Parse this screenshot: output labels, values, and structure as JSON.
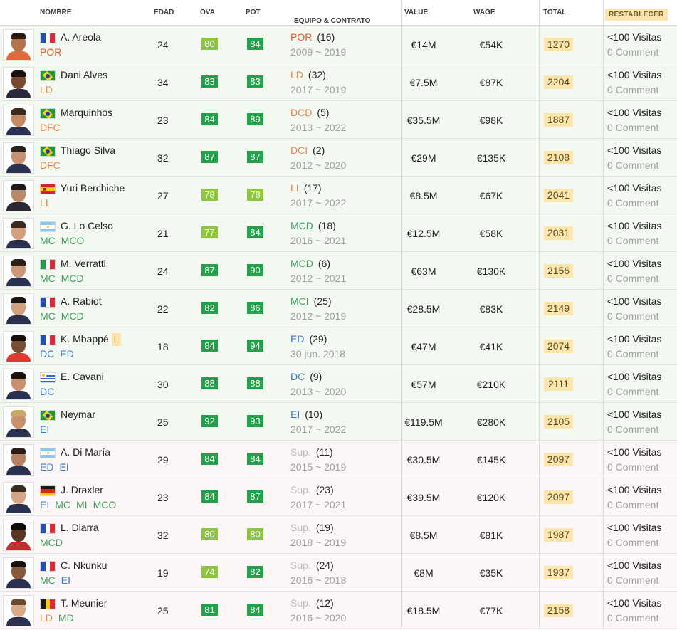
{
  "header": {
    "name": "NOMBRE",
    "age": "EDAD",
    "ova": "OVA",
    "pot": "POT",
    "team": "EQUIPO & CONTRATO",
    "value": "VALUE",
    "wage": "WAGE",
    "total": "TOTAL",
    "reset": "RESTABLECER"
  },
  "colors": {
    "green_dark": "#22a14a",
    "green_light": "#8cc63f",
    "pos_orange": "#e8874a",
    "pos_red": "#e5572a",
    "pos_green": "#3f9e5e",
    "pos_blue": "#3c7ac7",
    "sub_grey": "#bdbdbd",
    "total_bg": "#fbe5ad"
  },
  "players": [
    {
      "name": "A. Areola",
      "flag": "france",
      "positions": [
        "POR"
      ],
      "pos_color": "#e5572a",
      "age": "24",
      "ova": "80",
      "ova_color": "#8cc63f",
      "pot": "84",
      "pot_color": "#22a14a",
      "team_pos": "POR",
      "team_color": "#e5572a",
      "num": "(16)",
      "contract": "2009 ~ 2019",
      "value": "€14M",
      "wage": "€54K",
      "total": "1270",
      "visits": "<100 Visitas",
      "comments": "0 Comment",
      "bg": "green",
      "skin": "#b5714a",
      "hair": "#2a1a10",
      "shirt": "#e06b3a"
    },
    {
      "name": "Dani Alves",
      "flag": "brazil",
      "positions": [
        "LD"
      ],
      "pos_color": "#e8874a",
      "age": "34",
      "ova": "83",
      "ova_color": "#22a14a",
      "pot": "83",
      "pot_color": "#22a14a",
      "team_pos": "LD",
      "team_color": "#e8874a",
      "num": "(32)",
      "contract": "2017 ~ 2019",
      "value": "€7.5M",
      "wage": "€87K",
      "total": "2204",
      "visits": "<100 Visitas",
      "comments": "0 Comment",
      "bg": "green",
      "skin": "#7a4a30",
      "hair": "#1a1210",
      "shirt": "#2a2a3a"
    },
    {
      "name": "Marquinhos",
      "flag": "brazil",
      "positions": [
        "DFC"
      ],
      "pos_color": "#e8874a",
      "age": "23",
      "ova": "84",
      "ova_color": "#22a14a",
      "pot": "89",
      "pot_color": "#22a14a",
      "team_pos": "DCD",
      "team_color": "#e8874a",
      "num": "(5)",
      "contract": "2013 ~ 2022",
      "value": "€35.5M",
      "wage": "€98K",
      "total": "1887",
      "visits": "<100 Visitas",
      "comments": "0 Comment",
      "bg": "green",
      "skin": "#c48a64",
      "hair": "#3a2a1e",
      "shirt": "#2a3050"
    },
    {
      "name": "Thiago Silva",
      "flag": "brazil",
      "positions": [
        "DFC"
      ],
      "pos_color": "#e8874a",
      "age": "32",
      "ova": "87",
      "ova_color": "#22a14a",
      "pot": "87",
      "pot_color": "#22a14a",
      "team_pos": "DCI",
      "team_color": "#e8874a",
      "num": "(2)",
      "contract": "2012 ~ 2020",
      "value": "€29M",
      "wage": "€135K",
      "total": "2108",
      "visits": "<100 Visitas",
      "comments": "0 Comment",
      "bg": "green",
      "skin": "#c89070",
      "hair": "#2a2420",
      "shirt": "#2a3050"
    },
    {
      "name": "Yuri Berchiche",
      "flag": "spain",
      "positions": [
        "LI"
      ],
      "pos_color": "#e8874a",
      "age": "27",
      "ova": "78",
      "ova_color": "#8cc63f",
      "pot": "78",
      "pot_color": "#8cc63f",
      "team_pos": "LI",
      "team_color": "#e8874a",
      "num": "(17)",
      "contract": "2017 ~ 2022",
      "value": "€8.5M",
      "wage": "€67K",
      "total": "2041",
      "visits": "<100 Visitas",
      "comments": "0 Comment",
      "bg": "green",
      "skin": "#b88868",
      "hair": "#1e1814",
      "shirt": "#2a2a34"
    },
    {
      "name": "G. Lo Celso",
      "flag": "argentina",
      "positions": [
        "MC",
        "MCO"
      ],
      "pos_color": "#3f9e5e",
      "age": "21",
      "ova": "77",
      "ova_color": "#8cc63f",
      "pot": "84",
      "pot_color": "#22a14a",
      "team_pos": "MCD",
      "team_color": "#3f9e5e",
      "num": "(18)",
      "contract": "2016 ~ 2021",
      "value": "€12.5M",
      "wage": "€58K",
      "total": "2031",
      "visits": "<100 Visitas",
      "comments": "0 Comment",
      "bg": "green",
      "skin": "#d4a080",
      "hair": "#3a2a20",
      "shirt": "#2a3050"
    },
    {
      "name": "M. Verratti",
      "flag": "italy",
      "positions": [
        "MC",
        "MCD"
      ],
      "pos_color": "#3f9e5e",
      "age": "24",
      "ova": "87",
      "ova_color": "#22a14a",
      "pot": "90",
      "pot_color": "#22a14a",
      "team_pos": "MCD",
      "team_color": "#3f9e5e",
      "num": "(6)",
      "contract": "2012 ~ 2021",
      "value": "€63M",
      "wage": "€130K",
      "total": "2156",
      "visits": "<100 Visitas",
      "comments": "0 Comment",
      "bg": "green",
      "skin": "#c89878",
      "hair": "#2a2018",
      "shirt": "#2a3050"
    },
    {
      "name": "A. Rabiot",
      "flag": "france",
      "positions": [
        "MC",
        "MCD"
      ],
      "pos_color": "#3f9e5e",
      "age": "22",
      "ova": "82",
      "ova_color": "#22a14a",
      "pot": "86",
      "pot_color": "#22a14a",
      "team_pos": "MCI",
      "team_color": "#3f9e5e",
      "num": "(25)",
      "contract": "2012 ~ 2019",
      "value": "€28.5M",
      "wage": "€83K",
      "total": "2149",
      "visits": "<100 Visitas",
      "comments": "0 Comment",
      "bg": "green",
      "skin": "#d0a080",
      "hair": "#1e1410",
      "shirt": "#2a3050"
    },
    {
      "name": "K. Mbappé",
      "loan": "L",
      "flag": "france",
      "positions": [
        "DC",
        "ED"
      ],
      "pos_color": "#3c7ac7",
      "age": "18",
      "ova": "84",
      "ova_color": "#22a14a",
      "pot": "94",
      "pot_color": "#22a14a",
      "team_pos": "ED",
      "team_color": "#3c7ac7",
      "num": "(29)",
      "contract": "30 jun. 2018",
      "value": "€47M",
      "wage": "€41K",
      "total": "2074",
      "visits": "<100 Visitas",
      "comments": "0 Comment",
      "bg": "green",
      "skin": "#7a4e34",
      "hair": "#140e0a",
      "shirt": "#e03a30"
    },
    {
      "name": "E. Cavani",
      "flag": "uruguay",
      "positions": [
        "DC"
      ],
      "pos_color": "#3c7ac7",
      "age": "30",
      "ova": "88",
      "ova_color": "#22a14a",
      "pot": "88",
      "pot_color": "#22a14a",
      "team_pos": "DC",
      "team_color": "#3c7ac7",
      "num": "(9)",
      "contract": "2013 ~ 2020",
      "value": "€57M",
      "wage": "€210K",
      "total": "2111",
      "visits": "<100 Visitas",
      "comments": "0 Comment",
      "bg": "green",
      "skin": "#c89070",
      "hair": "#1a120c",
      "shirt": "#2a3050"
    },
    {
      "name": "Neymar",
      "flag": "brazil",
      "positions": [
        "EI"
      ],
      "pos_color": "#3c7ac7",
      "age": "25",
      "ova": "92",
      "ova_color": "#22a14a",
      "pot": "93",
      "pot_color": "#22a14a",
      "team_pos": "EI",
      "team_color": "#3c7ac7",
      "num": "(10)",
      "contract": "2017 ~ 2022",
      "value": "€119.5M",
      "wage": "€280K",
      "total": "2105",
      "visits": "<100 Visitas",
      "comments": "0 Comment",
      "bg": "green",
      "skin": "#c8906c",
      "hair": "#c8a868",
      "shirt": "#2a3050"
    },
    {
      "name": "A. Di María",
      "flag": "argentina",
      "positions": [
        "ED",
        "EI"
      ],
      "pos_color": "#3c7ac7",
      "age": "29",
      "ova": "84",
      "ova_color": "#22a14a",
      "pot": "84",
      "pot_color": "#22a14a",
      "team_pos": "Sup.",
      "team_color": "#bdbdbd",
      "num": "(11)",
      "contract": "2015 ~ 2019",
      "value": "€30.5M",
      "wage": "€145K",
      "total": "2097",
      "visits": "<100 Visitas",
      "comments": "0 Comment",
      "bg": "pink",
      "skin": "#b88060",
      "hair": "#2a1e16",
      "shirt": "#2a3050"
    },
    {
      "name": "J. Draxler",
      "flag": "germany",
      "positions": [
        "EI",
        "MC",
        "MI",
        "MCO"
      ],
      "pos_color": "#3f9e5e",
      "first_blue": true,
      "age": "23",
      "ova": "84",
      "ova_color": "#22a14a",
      "pot": "87",
      "pot_color": "#22a14a",
      "team_pos": "Sup.",
      "team_color": "#bdbdbd",
      "num": "(23)",
      "contract": "2017 ~ 2021",
      "value": "€39.5M",
      "wage": "€120K",
      "total": "2097",
      "visits": "<100 Visitas",
      "comments": "0 Comment",
      "bg": "pink",
      "skin": "#d4a484",
      "hair": "#3a2a1e",
      "shirt": "#2a3050"
    },
    {
      "name": "L. Diarra",
      "flag": "france",
      "positions": [
        "MCD"
      ],
      "pos_color": "#3f9e5e",
      "age": "32",
      "ova": "80",
      "ova_color": "#8cc63f",
      "pot": "80",
      "pot_color": "#8cc63f",
      "team_pos": "Sup.",
      "team_color": "#bdbdbd",
      "num": "(19)",
      "contract": "2018 ~ 2019",
      "value": "€8.5M",
      "wage": "€81K",
      "total": "1987",
      "visits": "<100 Visitas",
      "comments": "0 Comment",
      "bg": "pink",
      "skin": "#5a3624",
      "hair": "#140e0a",
      "shirt": "#c03030"
    },
    {
      "name": "C. Nkunku",
      "flag": "france",
      "positions": [
        "MC",
        "EI"
      ],
      "pos_color": "#3f9e5e",
      "second_blue": true,
      "age": "19",
      "ova": "74",
      "ova_color": "#8cc63f",
      "pot": "82",
      "pot_color": "#22a14a",
      "team_pos": "Sup.",
      "team_color": "#bdbdbd",
      "num": "(24)",
      "contract": "2016 ~ 2018",
      "value": "€8M",
      "wage": "€35K",
      "total": "1937",
      "visits": "<100 Visitas",
      "comments": "0 Comment",
      "bg": "pink",
      "skin": "#8a5a3c",
      "hair": "#1a120c",
      "shirt": "#2a3050"
    },
    {
      "name": "T. Meunier",
      "flag": "belgium",
      "positions": [
        "LD",
        "MD"
      ],
      "pos_color": "#e8874a",
      "second_green": true,
      "age": "25",
      "ova": "81",
      "ova_color": "#22a14a",
      "pot": "84",
      "pot_color": "#22a14a",
      "team_pos": "Sup.",
      "team_color": "#bdbdbd",
      "num": "(12)",
      "contract": "2016 ~ 2020",
      "value": "€18.5M",
      "wage": "€77K",
      "total": "2158",
      "visits": "<100 Visitas",
      "comments": "0 Comment",
      "bg": "pink",
      "skin": "#d8aa8a",
      "hair": "#6a4a30",
      "shirt": "#2a3050"
    }
  ]
}
